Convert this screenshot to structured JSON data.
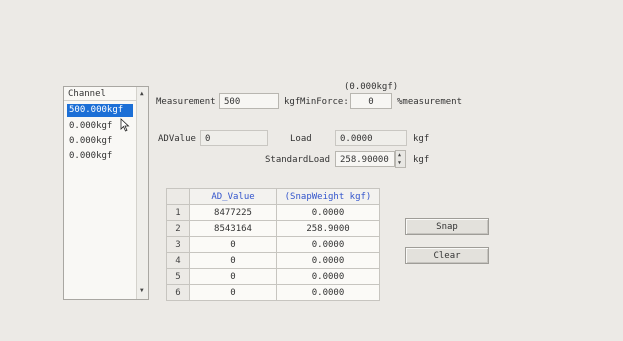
{
  "channel_list": {
    "header": "Channel",
    "items": [
      "500.000kgf",
      "0.000kgf",
      "0.000kgf",
      "0.000kgf"
    ],
    "selected_index": 0
  },
  "measurement": {
    "label": "Measurement",
    "value": "500",
    "unit": "kgf"
  },
  "min_force": {
    "header": "(0.000kgf)",
    "label": "MinForce:",
    "value": "0",
    "suffix": "%measurement"
  },
  "ad_value": {
    "label": "ADValue",
    "value": "0"
  },
  "load": {
    "label": "Load",
    "value": "0.0000",
    "unit": "kgf"
  },
  "standard_load": {
    "label": "StandardLoad",
    "value": "258.90000",
    "unit": "kgf"
  },
  "table": {
    "columns": [
      "AD_Value",
      "(SnapWeight kgf)"
    ],
    "rows": [
      {
        "index": "1",
        "ad_value": "8477225",
        "snap_weight": "0.0000"
      },
      {
        "index": "2",
        "ad_value": "8543164",
        "snap_weight": "258.9000"
      },
      {
        "index": "3",
        "ad_value": "0",
        "snap_weight": "0.0000"
      },
      {
        "index": "4",
        "ad_value": "0",
        "snap_weight": "0.0000"
      },
      {
        "index": "5",
        "ad_value": "0",
        "snap_weight": "0.0000"
      },
      {
        "index": "6",
        "ad_value": "0",
        "snap_weight": "0.0000"
      }
    ]
  },
  "buttons": {
    "snap": "Snap",
    "clear": "Clear"
  },
  "colors": {
    "selection": "#1c6fd6",
    "column_header_text": "#3355cc",
    "background": "#eceae6"
  }
}
